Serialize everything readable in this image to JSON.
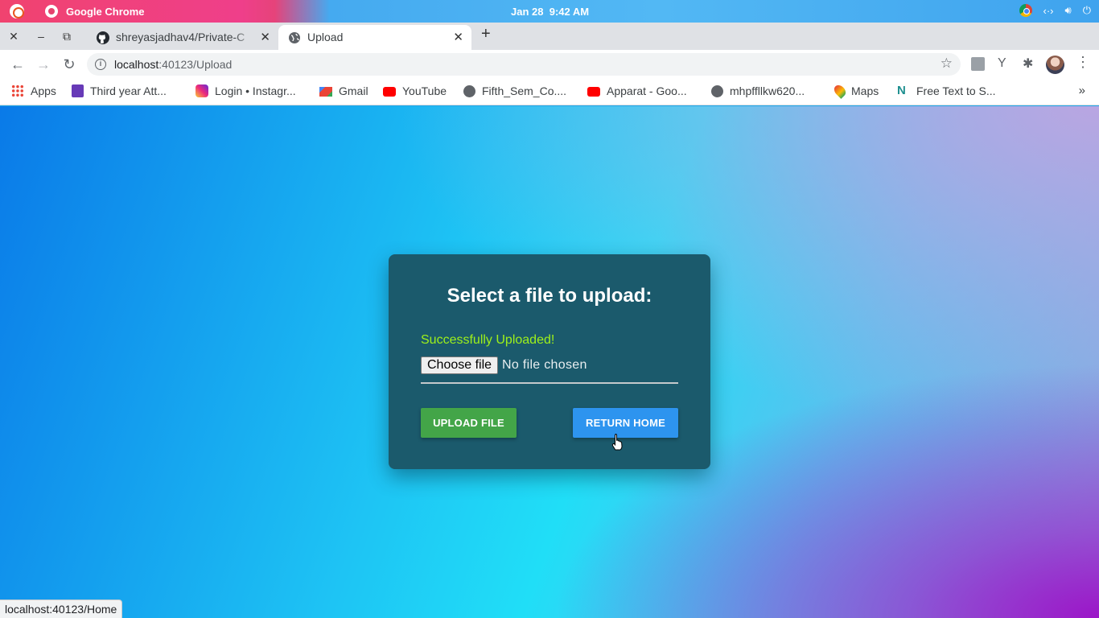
{
  "os": {
    "app_name": "Google Chrome",
    "date": "Jan 28",
    "time": "9:42 AM"
  },
  "tabs": [
    {
      "title": "shreyasjadhav4/Private-C",
      "icon": "github-icon"
    },
    {
      "title": "Upload",
      "icon": "globe-icon"
    }
  ],
  "address": {
    "host": "localhost",
    "path": ":40123/Upload"
  },
  "bookmarks": [
    {
      "label": "Apps",
      "icon": "apps-grid-icon"
    },
    {
      "label": "Third year Att...",
      "icon": "forms-icon"
    },
    {
      "label": "Login • Instagr...",
      "icon": "instagram-icon"
    },
    {
      "label": "Gmail",
      "icon": "gmail-icon"
    },
    {
      "label": "YouTube",
      "icon": "youtube-icon"
    },
    {
      "label": "Fifth_Sem_Co....",
      "icon": "globe-icon"
    },
    {
      "label": "Apparat - Goo...",
      "icon": "youtube-icon"
    },
    {
      "label": "mhpffllkw620...",
      "icon": "globe-icon"
    },
    {
      "label": "Maps",
      "icon": "maps-icon"
    },
    {
      "label": "Free Text to S...",
      "icon": "n-icon"
    }
  ],
  "bookmarks_overflow": "»",
  "card": {
    "title": "Select a file to upload:",
    "success_message": "Successfully Uploaded!",
    "choose_file_label": "Choose file",
    "no_file_text": "No file chosen",
    "upload_button": "UPLOAD FILE",
    "return_button": "RETURN HOME"
  },
  "status_url": "localhost:40123/Home",
  "colors": {
    "card_bg": "#1b5a6c",
    "success": "#9ef01a",
    "upload_btn": "#43a548",
    "return_btn": "#2d94ef"
  }
}
